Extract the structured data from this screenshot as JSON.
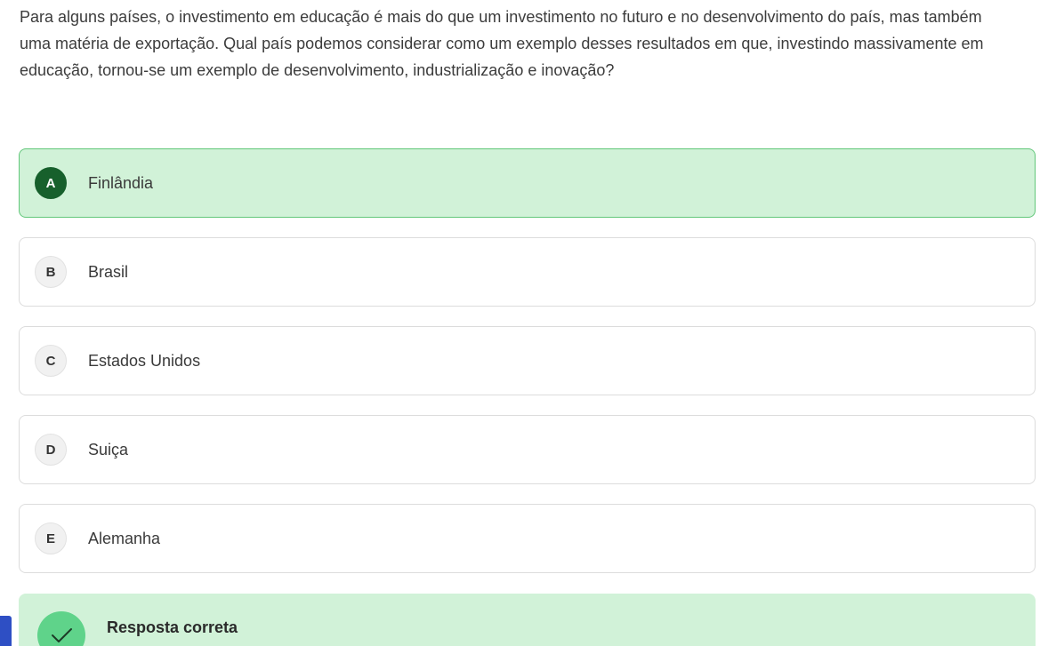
{
  "question": {
    "text": "Para alguns países, o investimento em educação é mais do que um investimento no futuro e no desenvolvimento do país, mas também uma matéria de exportação. Qual país podemos considerar como um exemplo desses resultados em que, investindo massivamente em educação, tornou-se um exemplo de desenvolvimento, industrialização e inovação?"
  },
  "options": [
    {
      "letter": "A",
      "label": "Finlândia",
      "state": "correct"
    },
    {
      "letter": "B",
      "label": "Brasil",
      "state": "default"
    },
    {
      "letter": "C",
      "label": "Estados Unidos",
      "state": "default"
    },
    {
      "letter": "D",
      "label": "Suiça",
      "state": "default"
    },
    {
      "letter": "E",
      "label": "Alemanha",
      "state": "default"
    }
  ],
  "feedback": {
    "title": "Resposta correta",
    "icon": "check-icon"
  },
  "colors": {
    "correct_bg": "#d1f2d8",
    "correct_border": "#62c77a",
    "correct_letter_bg": "#17602c",
    "feedback_icon_bg": "#5fd38a",
    "side_tab": "#2e4fc4"
  }
}
